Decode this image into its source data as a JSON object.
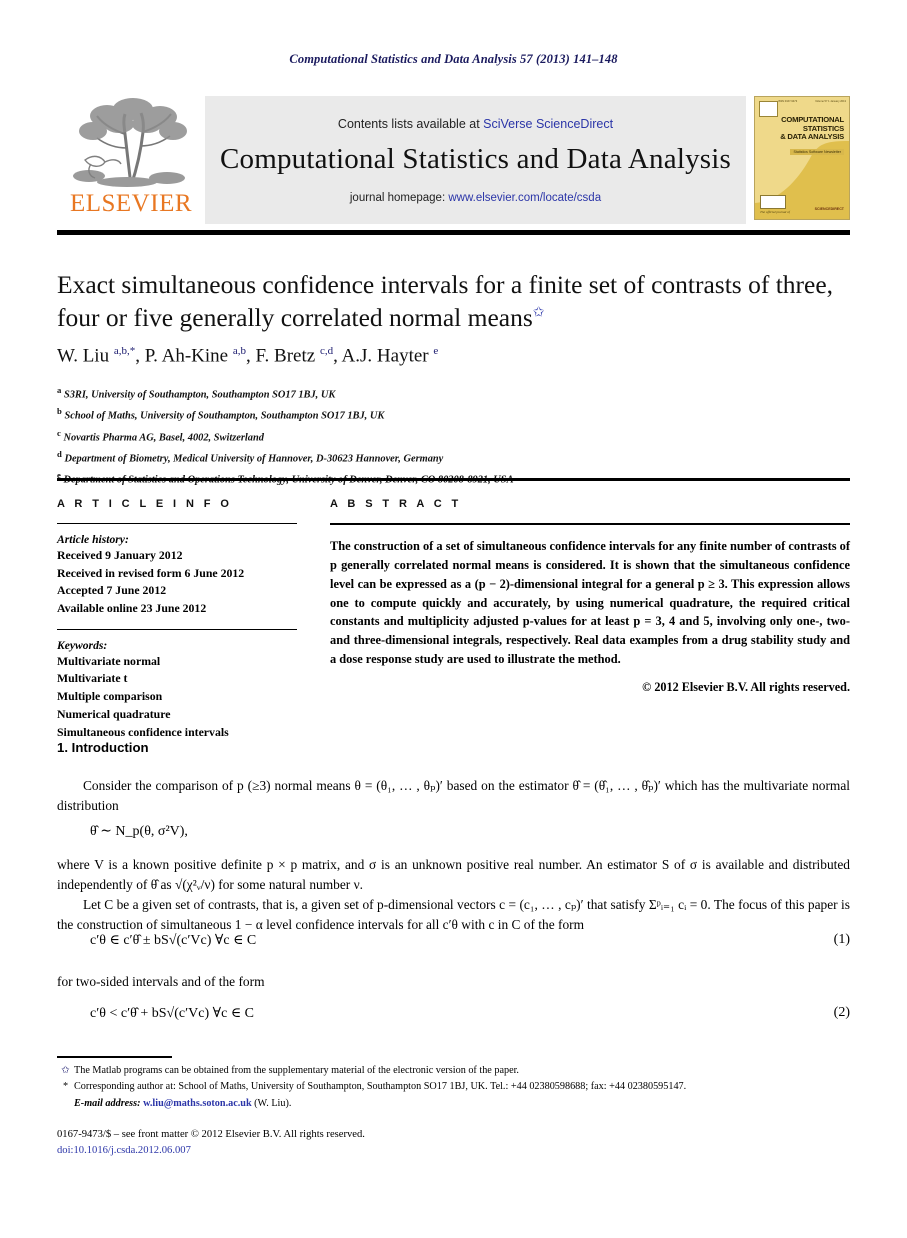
{
  "running_head": "Computational Statistics and Data Analysis 57 (2013) 141–148",
  "banner": {
    "publisher_wordmark": "ELSEVIER",
    "contents_prefix": "Contents lists available at ",
    "contents_link": "SciVerse ScienceDirect",
    "journal_name": "Computational Statistics and Data Analysis",
    "homepage_prefix": "journal homepage: ",
    "homepage_url": "www.elsevier.com/locate/csda",
    "cover": {
      "title_line1": "COMPUTATIONAL",
      "title_line2": "STATISTICS",
      "title_line3": "& DATA ANALYSIS",
      "subtitle": "Statistics Software Newsletter",
      "issn": "ISSN 0167-9473",
      "volume": "Volume 57  1 January 2013",
      "caption": "The official journal of",
      "sciencedirect": "SCIENCEDIRECT"
    }
  },
  "article": {
    "title": "Exact simultaneous confidence intervals for a finite set of contrasts of three, four or five generally correlated normal means",
    "title_footnote_marker": "✩",
    "authors_html": "W. Liu <sup>a,b,*</sup>, P. Ah-Kine <sup>a,b</sup>, F. Bretz <sup>c,d</sup>, A.J. Hayter <sup>e</sup>",
    "affiliations": [
      {
        "mark": "a",
        "text": "S3RI, University of Southampton, Southampton SO17 1BJ, UK"
      },
      {
        "mark": "b",
        "text": "School of Maths, University of Southampton, Southampton SO17 1BJ, UK"
      },
      {
        "mark": "c",
        "text": "Novartis Pharma AG, Basel, 4002, Switzerland"
      },
      {
        "mark": "d",
        "text": "Department of Biometry, Medical University of Hannover, D-30623 Hannover, Germany"
      },
      {
        "mark": "e",
        "text": "Department of Statistics and Operations Technology, University of Denver, Denver, CO 80208-8921, USA"
      }
    ]
  },
  "article_info": {
    "heading": "A R T I C L E    I N F O",
    "history_label": "Article history:",
    "history": [
      "Received 9 January 2012",
      "Received in revised form 6 June 2012",
      "Accepted 7 June 2012",
      "Available online 23 June 2012"
    ],
    "keywords_label": "Keywords:",
    "keywords": [
      "Multivariate normal",
      "Multivariate t",
      "Multiple comparison",
      "Numerical quadrature",
      "Simultaneous confidence intervals"
    ]
  },
  "abstract": {
    "heading": "A B S T R A C T",
    "text": "The construction of a set of simultaneous confidence intervals for any finite number of contrasts of p generally correlated normal means is considered. It is shown that the simultaneous confidence level can be expressed as a (p − 2)-dimensional integral for a general p ≥ 3. This expression allows one to compute quickly and accurately, by using numerical quadrature, the required critical constants and multiplicity adjusted p-values for at least p = 3, 4 and 5, involving only one-, two- and three-dimensional integrals, respectively. Real data examples from a drug stability study and a dose response study are used to illustrate the method.",
    "copyright": "© 2012 Elsevier B.V. All rights reserved."
  },
  "body": {
    "intro_heading": "1. Introduction",
    "para1": "Consider the comparison of p (≥3) normal means θ = (θ₁, … , θₚ)′ based on the estimator θ̂ = (θ̂₁, … , θ̂ₚ)′ which has the multivariate normal distribution",
    "eq_distribution": "θ̂ ∼ N_p(θ, σ²V),",
    "para2": "where V is a known positive definite p × p matrix, and σ is an unknown positive real number. An estimator S of σ is available and distributed independently of θ̂ as √(χ²ᵥ/ν) for some natural number ν.",
    "para3": "Let C be a given set of contrasts, that is, a given set of p-dimensional vectors c = (c₁, … , cₚ)′ that satisfy Σᵖᵢ₌₁ cᵢ = 0. The focus of this paper is the construction of simultaneous 1 − α level confidence intervals for all c′θ with c in C of the form",
    "eq1": "c′θ ∈ c′θ̂ ± bS√(c′Vc)   ∀c ∈ C",
    "eq1_number": "(1)",
    "para4": "for two-sided intervals and of the form",
    "eq2": "c′θ < c′θ̂ + bS√(c′Vc)   ∀c ∈ C",
    "eq2_number": "(2)"
  },
  "footnotes": {
    "star_mark": "✩",
    "star_text": "The Matlab programs can be obtained from the supplementary material of the electronic version of the paper.",
    "corr_mark": "*",
    "corr_text": "Corresponding author at: School of Maths, University of Southampton, Southampton SO17 1BJ, UK. Tel.: +44 02380598688; fax: +44 02380595147.",
    "email_label": "E-mail address:",
    "email_address": "w.liu@maths.soton.ac.uk",
    "email_who": "(W. Liu)."
  },
  "imprint": {
    "issn_line": "0167-9473/$ – see front matter © 2012 Elsevier B.V. All rights reserved.",
    "doi": "doi:10.1016/j.csda.2012.06.007"
  }
}
